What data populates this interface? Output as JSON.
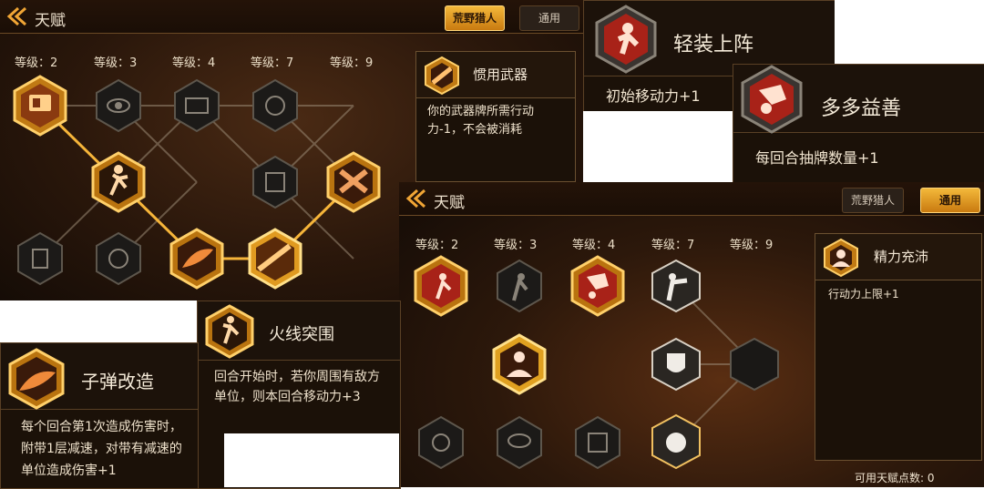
{
  "panel_a": {
    "title": "天赋",
    "tabs": [
      "荒野猎人",
      "通用"
    ],
    "levels": [
      "等级：2",
      "等级：3",
      "等级：4",
      "等级：7",
      "等级：9"
    ],
    "info": {
      "name": "惯用武器",
      "desc": "你的武器牌所需行动力-1，不会被消耗"
    }
  },
  "card_light": {
    "name": "轻装上阵",
    "desc": "初始移动力+1"
  },
  "card_more": {
    "name": "多多益善",
    "desc": "每回合抽牌数量+1"
  },
  "panel_b": {
    "title": "天赋",
    "tabs": [
      "荒野猎人",
      "通用"
    ],
    "levels": [
      "等级：2",
      "等级：3",
      "等级：4",
      "等级：7",
      "等级：9"
    ],
    "info": {
      "name": "精力充沛",
      "desc": "行动力上限+1"
    },
    "points": "可用天赋点数: 0"
  },
  "card_fire": {
    "name": "火线突围",
    "desc": "回合开始时，若你周围有敌方单位，则本回合移动力+3"
  },
  "card_bullet": {
    "name": "子弹改造",
    "desc": "每个回合第1次造成伤害时，附带1层减速，对带有减速的单位造成伤害+1"
  },
  "colors": {
    "gold": "#f5b233",
    "dark": "#1a0f07",
    "selected_red": "#b3261e"
  }
}
